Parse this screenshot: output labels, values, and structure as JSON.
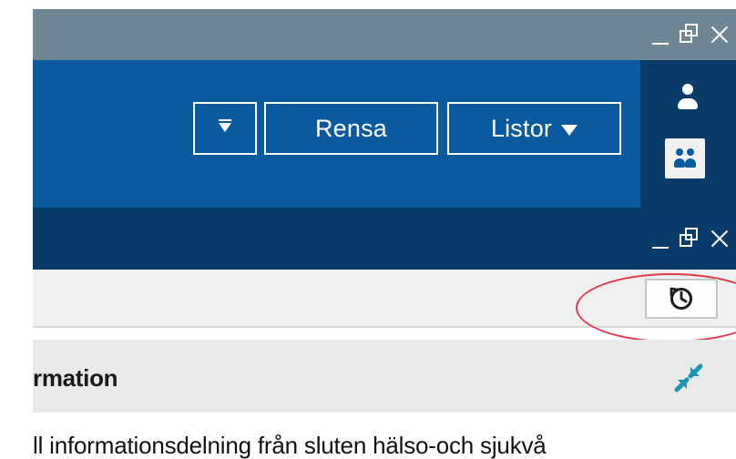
{
  "toolbar": {
    "filter_icon": "filter-icon",
    "rensa_label": "Rensa",
    "listor_label": "Listor"
  },
  "window_controls": {
    "top": [
      "minimize-icon",
      "restore-icon",
      "close-icon"
    ],
    "secondary": [
      "minimize-icon",
      "restore-icon",
      "close-icon"
    ]
  },
  "user_panel": {
    "user_icon": "person-icon",
    "group_icon": "group-icon"
  },
  "subtoolbar": {
    "history_icon": "history-icon",
    "highlight": "red-ellipse-highlight"
  },
  "section": {
    "title": "rmation",
    "collapse_icon": "collapse-arrows-icon"
  },
  "body": {
    "text": "ll informationsdelning från sluten hälso-och sjukvå"
  },
  "colors": {
    "top_bar": "#6f8694",
    "toolbar": "#0b5a9f",
    "dark_bar": "#083b69",
    "side_panel": "#0a3a68",
    "highlight_ring": "#e23a4a"
  }
}
